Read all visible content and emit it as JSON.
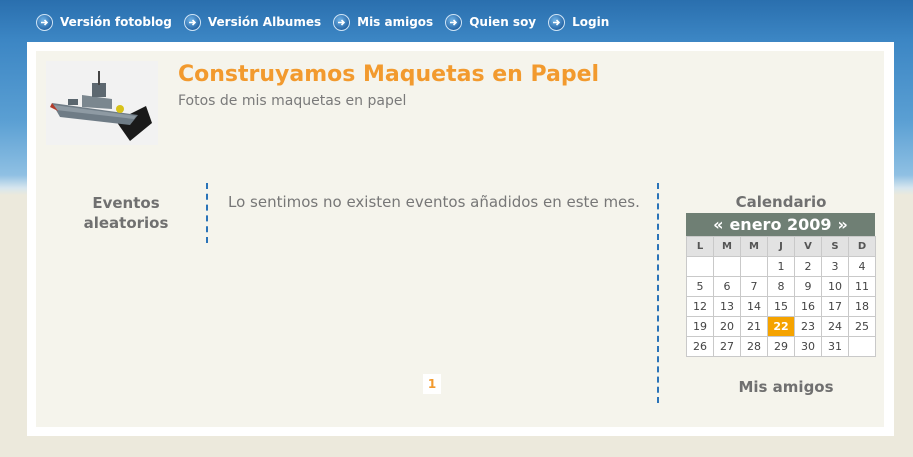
{
  "nav": {
    "items": [
      {
        "label": "Versión fotoblog"
      },
      {
        "label": "Versión Albumes"
      },
      {
        "label": "Mis amigos"
      },
      {
        "label": "Quien soy"
      },
      {
        "label": "Login"
      }
    ]
  },
  "header": {
    "title": "Construyamos Maquetas en Papel",
    "subtitle": "Fotos de mis maquetas en papel"
  },
  "sidebar_left": {
    "title_line1": "Eventos",
    "title_line2": "aleatorios"
  },
  "main": {
    "message": "Lo sentimos no existen eventos añadidos en este mes.",
    "pagination": [
      "1"
    ]
  },
  "calendar": {
    "title": "Calendario",
    "prev": "«",
    "month_label": "enero 2009",
    "next": "»",
    "weekdays": [
      "L",
      "M",
      "M",
      "J",
      "V",
      "S",
      "D"
    ],
    "weeks": [
      [
        "",
        "",
        "",
        "1",
        "2",
        "3",
        "4"
      ],
      [
        "5",
        "6",
        "7",
        "8",
        "9",
        "10",
        "11"
      ],
      [
        "12",
        "13",
        "14",
        "15",
        "16",
        "17",
        "18"
      ],
      [
        "19",
        "20",
        "21",
        "22",
        "23",
        "24",
        "25"
      ],
      [
        "26",
        "27",
        "28",
        "29",
        "30",
        "31",
        ""
      ]
    ],
    "today": "22",
    "today_color": "#f5a300"
  },
  "amigos": {
    "title": "Mis amigos"
  },
  "colors": {
    "accent": "#f29a2e",
    "nav_bg": "#2a6fae",
    "divider": "#2a73b8"
  }
}
